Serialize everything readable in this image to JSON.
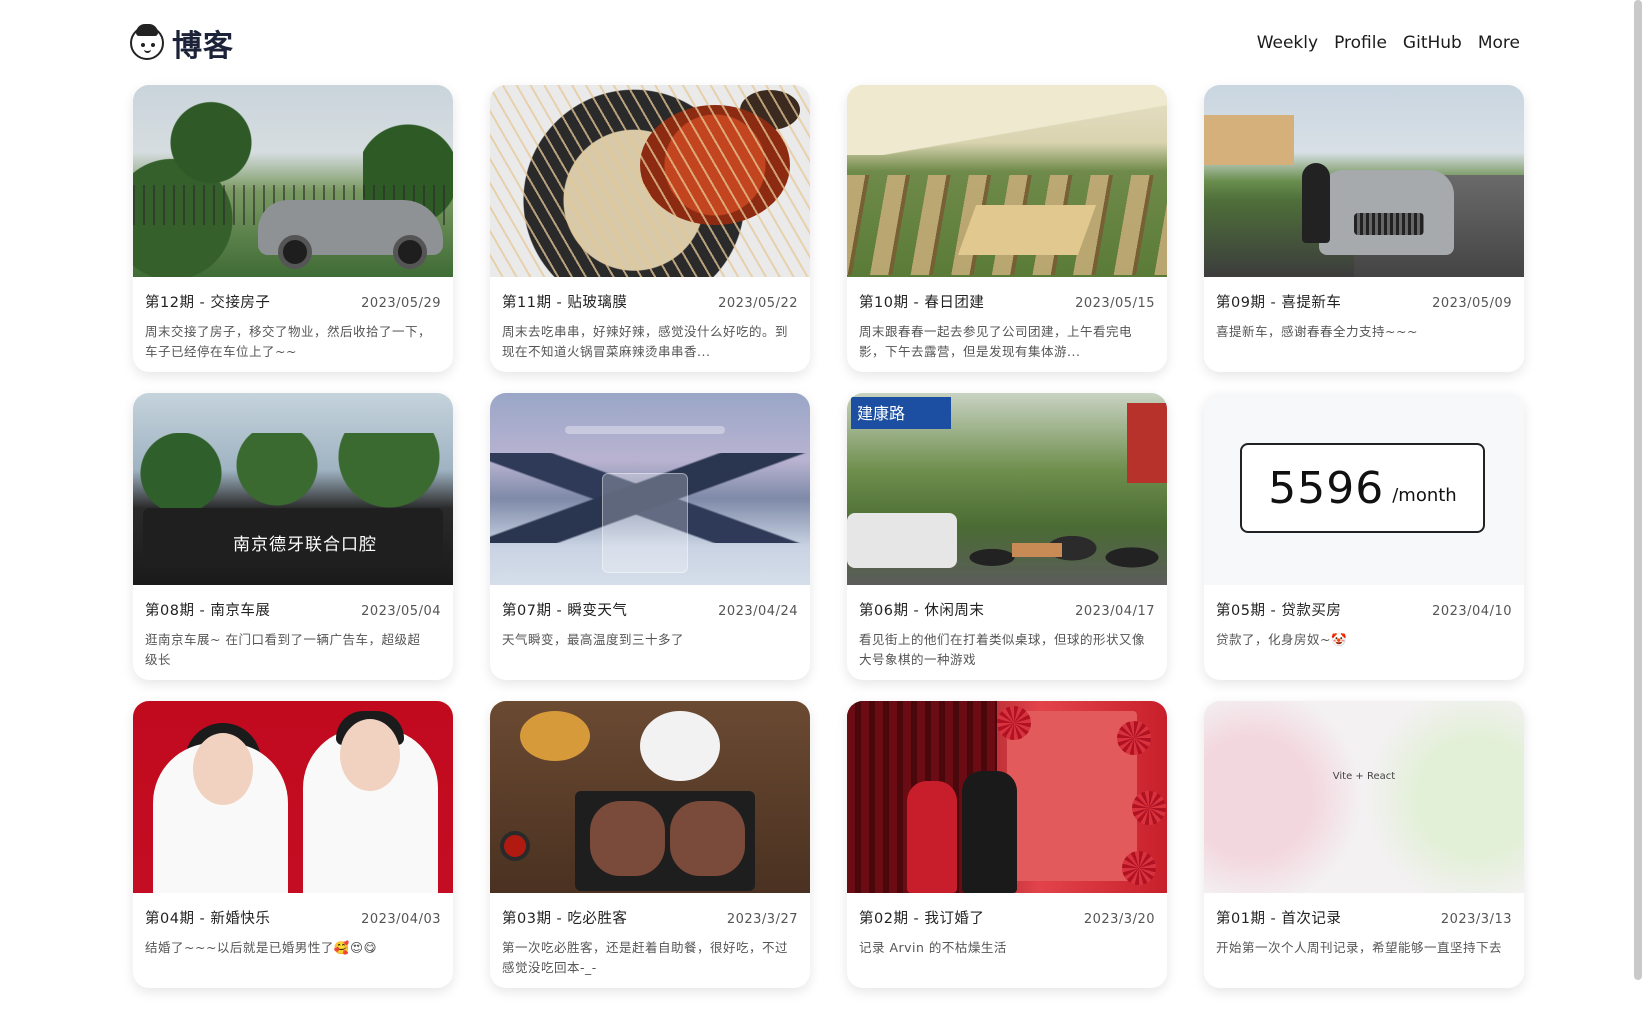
{
  "header": {
    "title": "博客",
    "nav": [
      "Weekly",
      "Profile",
      "GitHub",
      "More"
    ]
  },
  "cards": [
    {
      "title": "第12期 - 交接房子",
      "date": "2023/05/29",
      "desc": "周末交接了房子，移交了物业，然后收拾了一下，车子已经停在车位上了~~"
    },
    {
      "title": "第11期 - 贴玻璃膜",
      "date": "2023/05/22",
      "desc": "周末去吃串串，好辣好辣，感觉没什么好吃的。到现在不知道火锅冒菜麻辣烫串串香..."
    },
    {
      "title": "第10期 - 春日团建",
      "date": "2023/05/15",
      "desc": "周末跟春春一起去参见了公司团建，上午看完电影，下午去露营，但是发现有集体游..."
    },
    {
      "title": "第09期 - 喜提新车",
      "date": "2023/05/09",
      "desc": "喜提新车，感谢春春全力支持~~~"
    },
    {
      "title": "第08期 - 南京车展",
      "date": "2023/05/04",
      "desc": "逛南京车展~ 在门口看到了一辆广告车，超级超级长"
    },
    {
      "title": "第07期 - 瞬变天气",
      "date": "2023/04/24",
      "desc": "天气瞬变，最高温度到三十多了"
    },
    {
      "title": "第06期 - 休闲周末",
      "date": "2023/04/17",
      "desc": "看见街上的他们在打着类似桌球，但球的形状又像大号象棋的一种游戏"
    },
    {
      "title": "第05期 - 贷款买房",
      "date": "2023/04/10",
      "desc": "贷款了，化身房奴~🤡"
    },
    {
      "title": "第04期 - 新婚快乐",
      "date": "2023/04/03",
      "desc": "结婚了~~~以后就是已婚男性了🥰😍😋"
    },
    {
      "title": "第03期 - 吃必胜客",
      "date": "2023/3/27",
      "desc": "第一次吃必胜客，还是赶着自助餐，很好吃，不过感觉没吃回本-_-"
    },
    {
      "title": "第02期 - 我订婚了",
      "date": "2023/3/20",
      "desc": "记录 Arvin 的不枯燥生活"
    },
    {
      "title": "第01期 - 首次记录",
      "date": "2023/3/13",
      "desc": "开始第一次个人周刊记录，希望能够一直坚持下去"
    }
  ],
  "thumbs": {
    "truck_text": "南京德牙联合口腔",
    "street_sign": "建康路",
    "month_value": "5596",
    "month_unit": "/month",
    "vite_text": "Vite + React"
  }
}
